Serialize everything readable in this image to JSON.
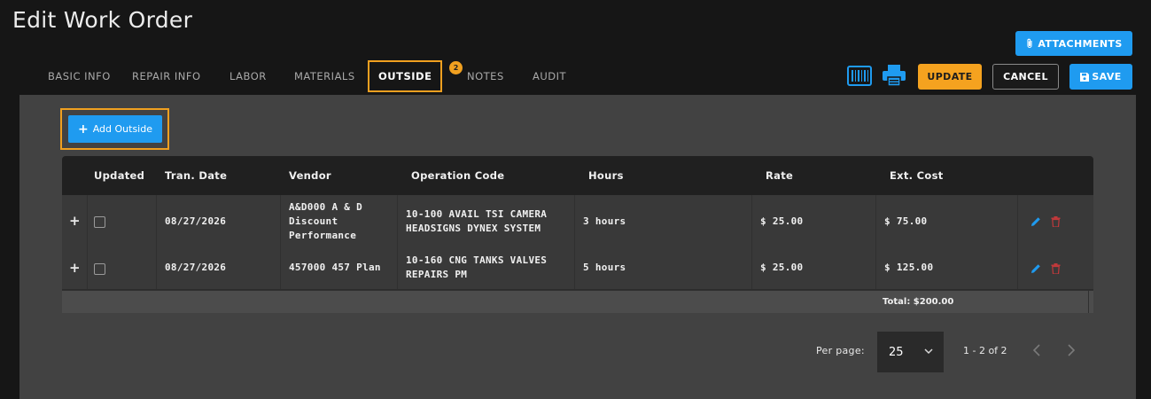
{
  "header": {
    "title": "Edit Work Order",
    "attachments_label": "ATTACHMENTS"
  },
  "tabs": [
    {
      "label": "BASIC INFO"
    },
    {
      "label": "REPAIR INFO"
    },
    {
      "label": "LABOR"
    },
    {
      "label": "MATERIALS"
    },
    {
      "label": "OUTSIDE",
      "active": true
    },
    {
      "label": "NOTES",
      "badge": "2"
    },
    {
      "label": "AUDIT"
    }
  ],
  "toolbar": {
    "update_label": "UPDATE",
    "cancel_label": "CANCEL",
    "save_label": "SAVE",
    "barcode_icon": "barcode-icon",
    "print_icon": "printer-icon"
  },
  "outside": {
    "add_label": "Add Outside",
    "columns": [
      "Updated",
      "Tran. Date",
      "Vendor",
      "Operation Code",
      "Hours",
      "Rate",
      "Ext. Cost"
    ],
    "rows": [
      {
        "tran_date": "08/27/2026",
        "vendor_lines": [
          "A&D000 A & D",
          "Discount",
          "Performance"
        ],
        "op_lines": [
          "10-100 AVAIL TSI CAMERA",
          "HEADSIGNS DYNEX SYSTEM"
        ],
        "hours": "3 hours",
        "rate": "$ 25.00",
        "ext_cost": "$ 75.00"
      },
      {
        "tran_date": "08/27/2026",
        "vendor_lines": [
          "457000 457 Plan"
        ],
        "op_lines": [
          "10-160 CNG TANKS VALVES",
          "REPAIRS PM"
        ],
        "hours": "5 hours",
        "rate": "$ 25.00",
        "ext_cost": "$ 125.00"
      }
    ],
    "total": "Total: $200.00"
  },
  "pagination": {
    "per_page_label": "Per page:",
    "per_page_value": "25",
    "range": "1 - 2 of 2"
  },
  "colors": {
    "accent_blue": "#1f9bf0",
    "accent_orange": "#f5a21f",
    "delete_red": "#c0393b"
  }
}
